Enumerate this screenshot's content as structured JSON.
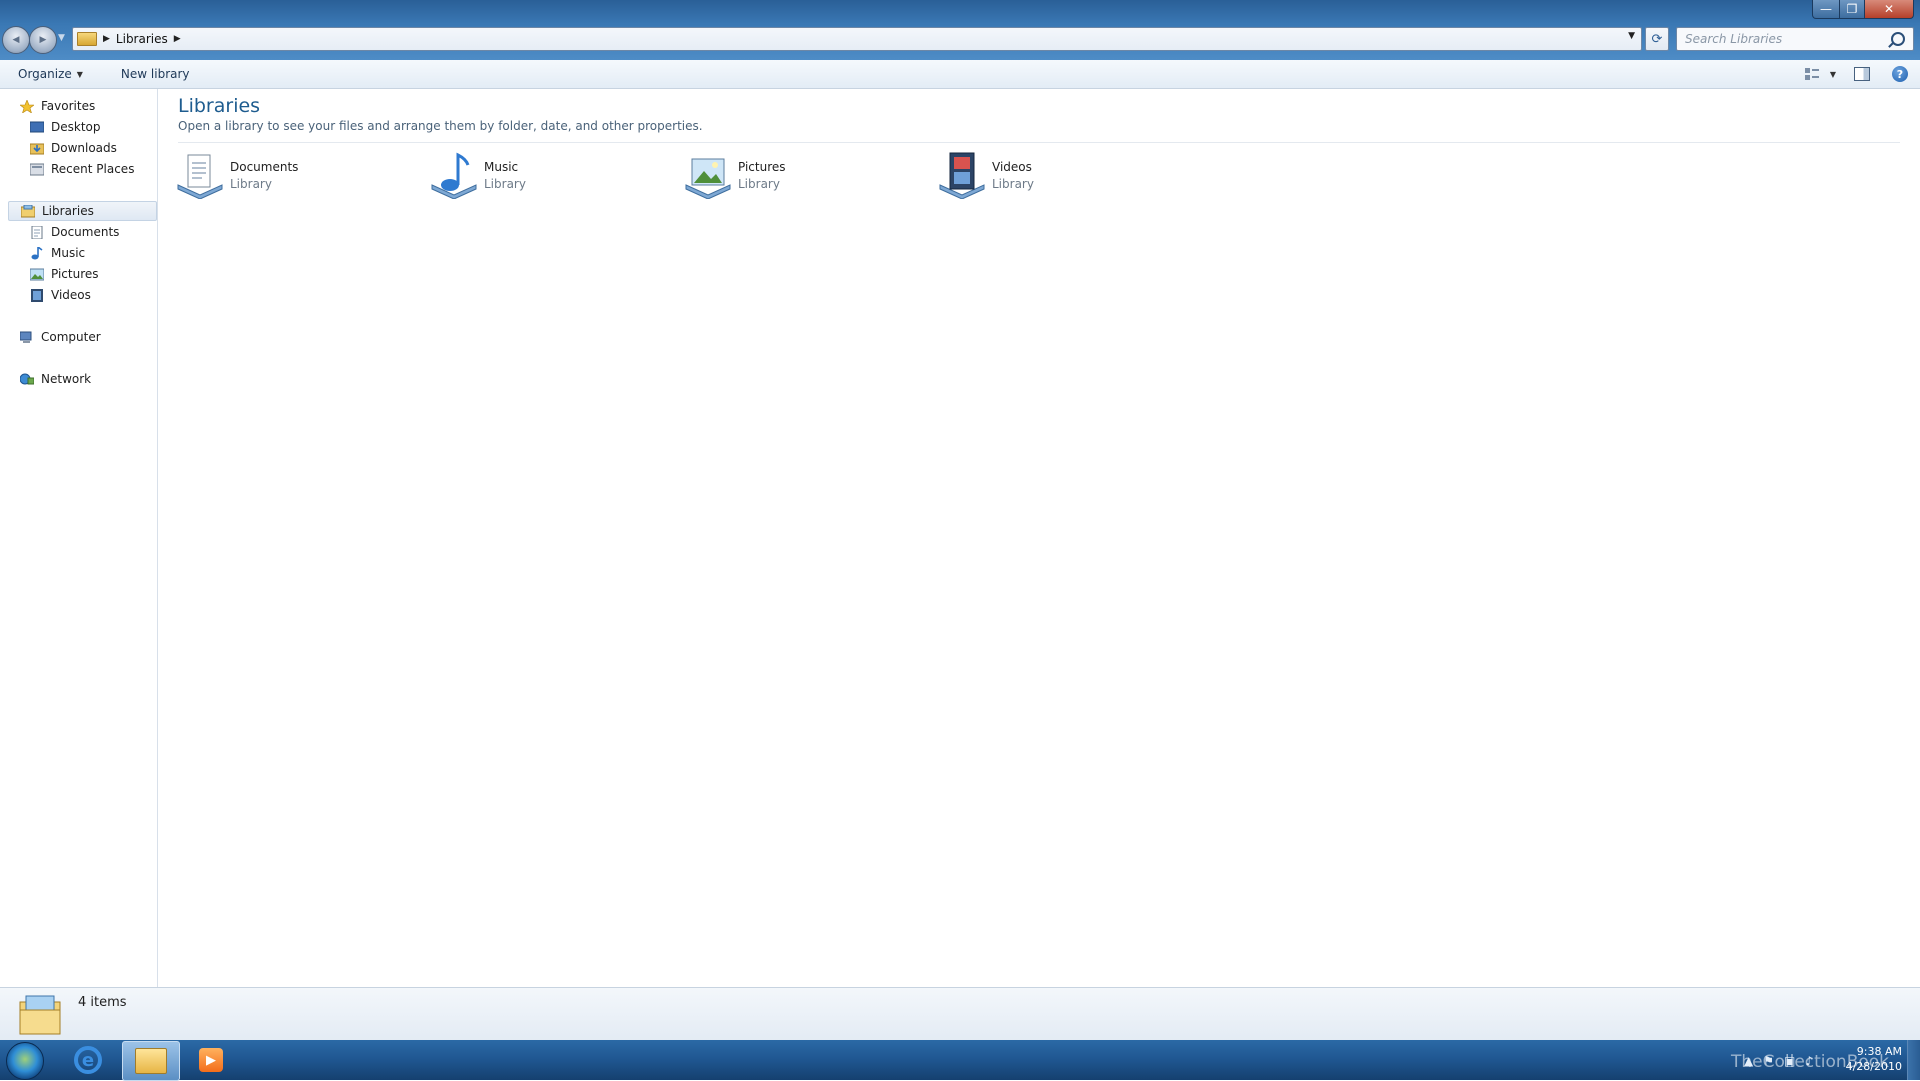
{
  "window": {
    "controls": {
      "minimize": "—",
      "maximize": "❐",
      "close": "✕"
    }
  },
  "nav": {
    "back_glyph": "◀",
    "forward_glyph": "▶"
  },
  "address": {
    "crumbs": [
      "Libraries"
    ],
    "separator": "▶",
    "dropdown_glyph": "▼"
  },
  "search": {
    "placeholder": "Search Libraries"
  },
  "toolbar": {
    "organize_label": "Organize",
    "new_library_label": "New library",
    "help_glyph": "?"
  },
  "sidebar": {
    "favorites": {
      "label": "Favorites",
      "items": [
        {
          "label": "Desktop"
        },
        {
          "label": "Downloads"
        },
        {
          "label": "Recent Places"
        }
      ]
    },
    "libraries": {
      "label": "Libraries",
      "items": [
        {
          "label": "Documents"
        },
        {
          "label": "Music"
        },
        {
          "label": "Pictures"
        },
        {
          "label": "Videos"
        }
      ]
    },
    "computer": {
      "label": "Computer"
    },
    "network": {
      "label": "Network"
    }
  },
  "main": {
    "title": "Libraries",
    "subtitle": "Open a library to see your files and arrange them by folder, date, and other properties.",
    "libraries": [
      {
        "name": "Documents",
        "type": "Library",
        "icon": "documents-library-icon"
      },
      {
        "name": "Music",
        "type": "Library",
        "icon": "music-library-icon"
      },
      {
        "name": "Pictures",
        "type": "Library",
        "icon": "pictures-library-icon"
      },
      {
        "name": "Videos",
        "type": "Library",
        "icon": "videos-library-icon"
      }
    ]
  },
  "status": {
    "item_count": "4 items"
  },
  "taskbar": {
    "watermark": "TheCollectionBook",
    "time": "9:38 AM",
    "date": "4/28/2010",
    "wmp_glyph": "▶",
    "ie_glyph": "e"
  },
  "colors": {
    "title_blue": "#1e5c8f",
    "taskbar": "#1f5690"
  }
}
